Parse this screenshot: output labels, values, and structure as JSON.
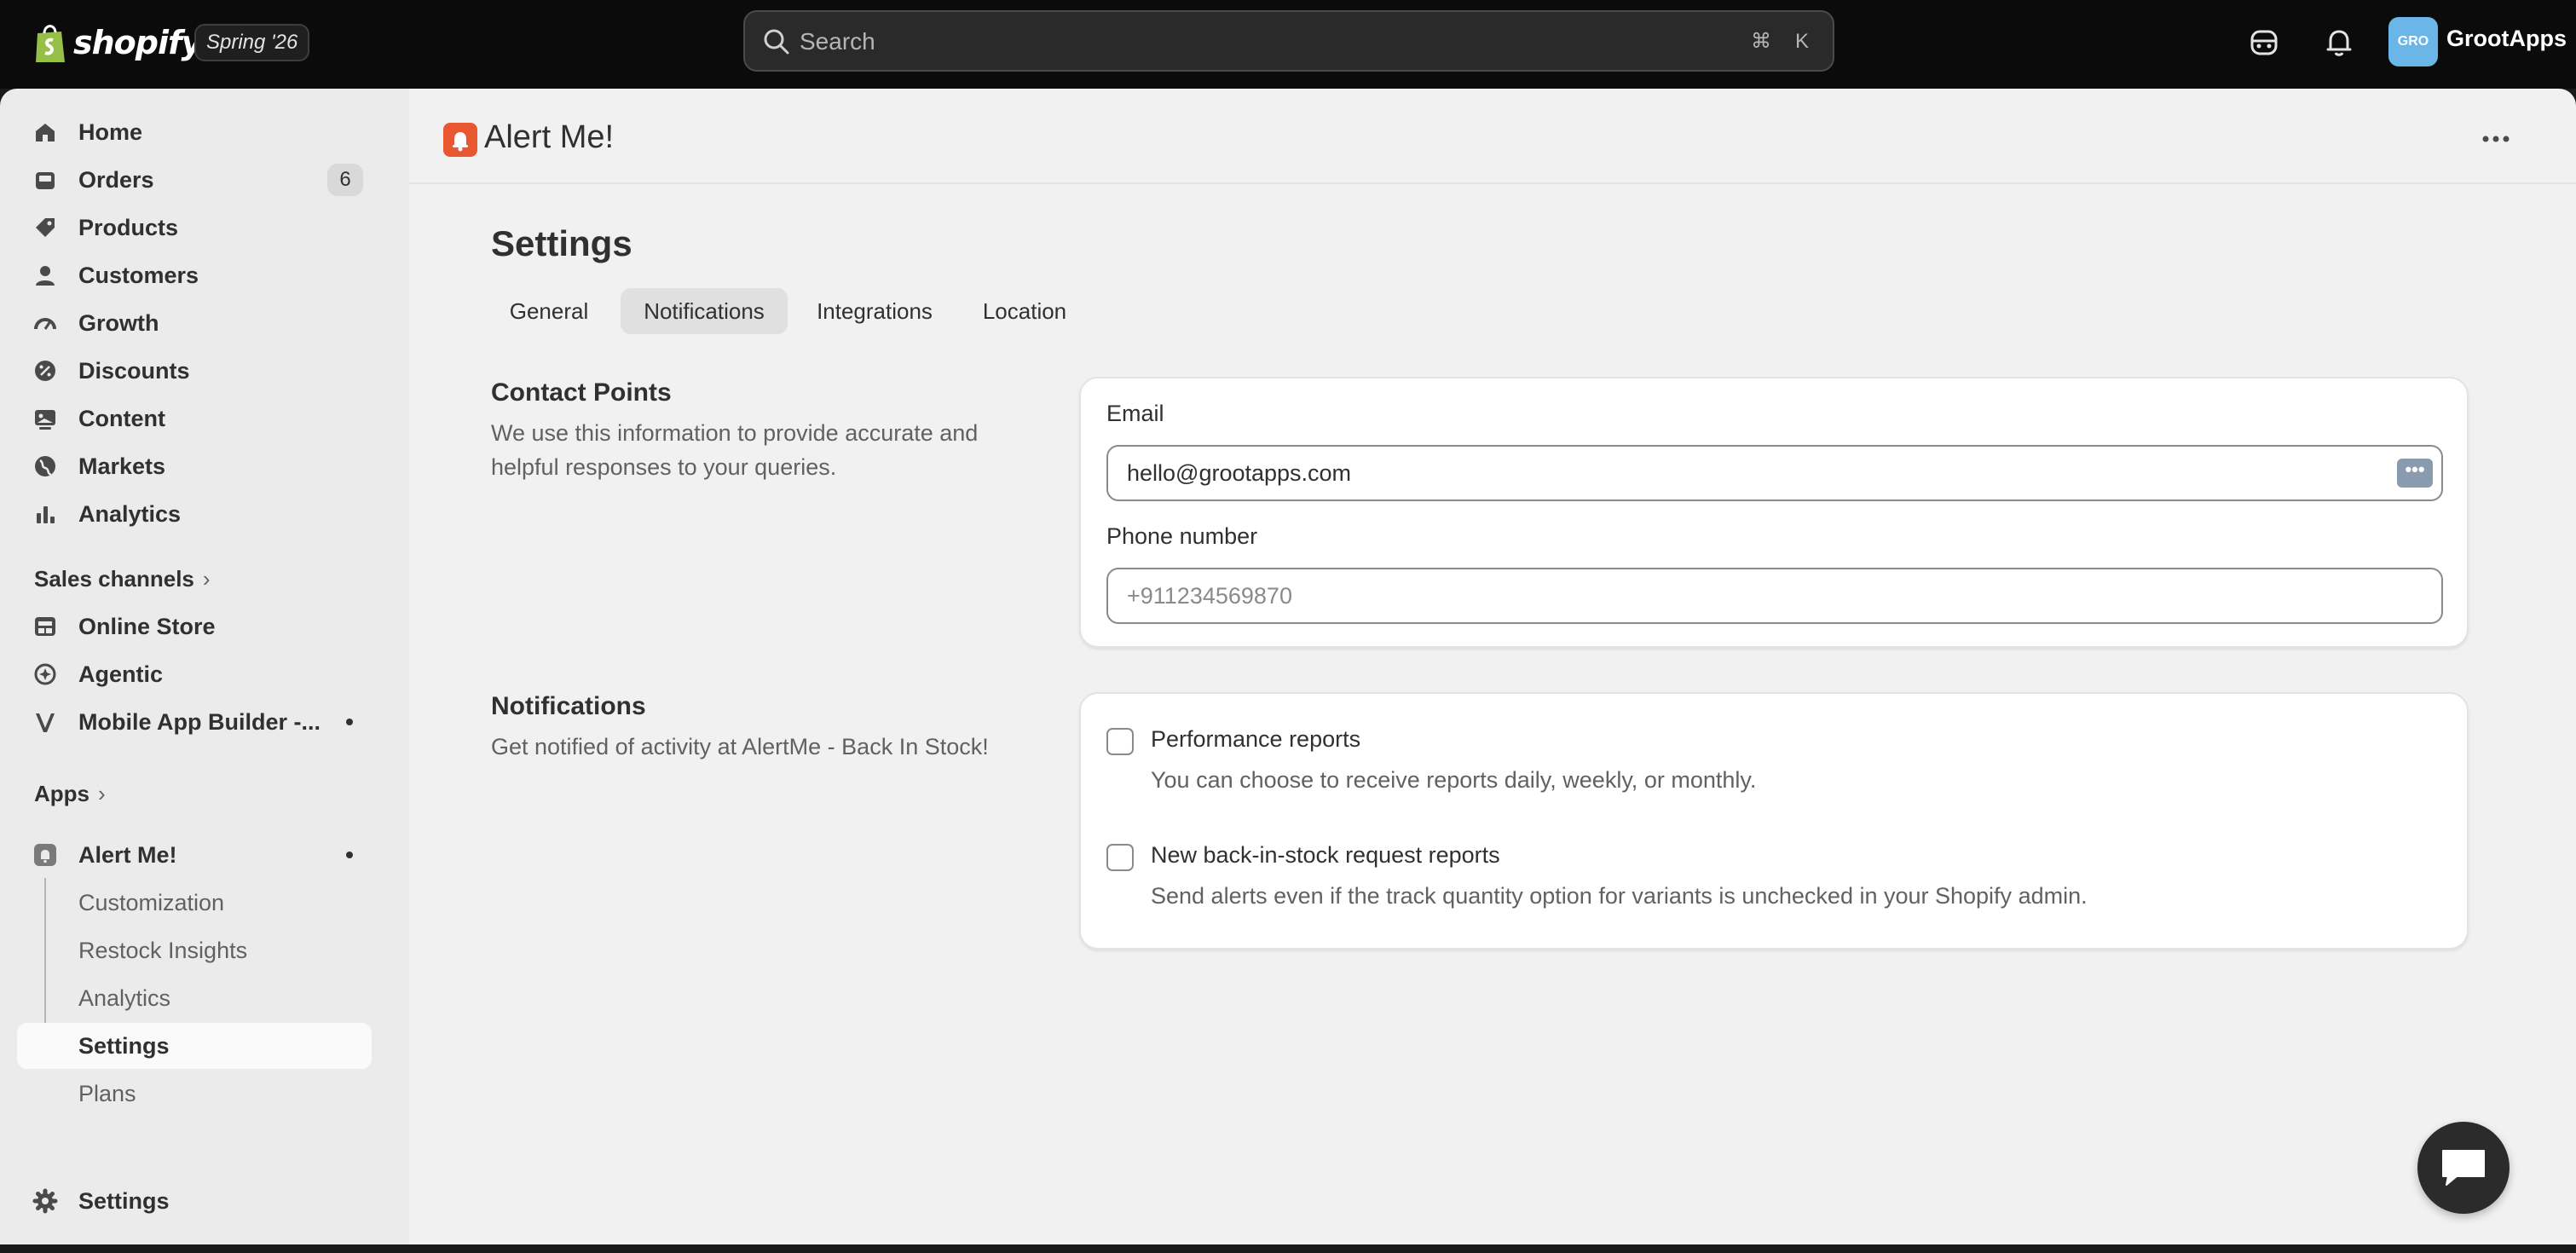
{
  "topbar": {
    "brand": "shopify",
    "edition": "Spring '26",
    "search_placeholder": "Search",
    "shortcut_cmd": "⌘",
    "shortcut_key": "K",
    "avatar_initials": "GRO",
    "store_name": "GrootApps"
  },
  "sidebar": {
    "items": [
      {
        "label": "Home",
        "icon": "home-icon"
      },
      {
        "label": "Orders",
        "icon": "orders-icon",
        "count": "6"
      },
      {
        "label": "Products",
        "icon": "tag-icon"
      },
      {
        "label": "Customers",
        "icon": "person-icon"
      },
      {
        "label": "Growth",
        "icon": "gauge-icon"
      },
      {
        "label": "Discounts",
        "icon": "discount-icon"
      },
      {
        "label": "Content",
        "icon": "image-icon"
      },
      {
        "label": "Markets",
        "icon": "globe-icon"
      },
      {
        "label": "Analytics",
        "icon": "bar-chart-icon"
      }
    ],
    "sales_channels_label": "Sales channels",
    "sales_channels": [
      {
        "label": "Online Store",
        "icon": "store-icon"
      },
      {
        "label": "Agentic",
        "icon": "sparkle-icon"
      },
      {
        "label": "Mobile App Builder -...",
        "icon": "v-logo-icon"
      }
    ],
    "apps_label": "Apps",
    "app": {
      "label": "Alert Me!",
      "icon": "bell-app-icon"
    },
    "app_subitems": [
      "Customization",
      "Restock Insights",
      "Analytics",
      "Settings",
      "Plans"
    ],
    "settings_label": "Settings"
  },
  "main": {
    "app_title": "Alert Me!",
    "page_title": "Settings",
    "tabs": [
      "General",
      "Notifications",
      "Integrations",
      "Location"
    ],
    "active_tab": "Notifications",
    "contact": {
      "title": "Contact Points",
      "description": "We use this information to provide accurate and helpful responses to your queries.",
      "email_label": "Email",
      "email_value": "hello@grootapps.com",
      "phone_label": "Phone number",
      "phone_placeholder": "+911234569870"
    },
    "notifications": {
      "title": "Notifications",
      "description": "Get notified of activity at AlertMe - Back In Stock!",
      "options": [
        {
          "label": "Performance reports",
          "help": "You can choose to receive reports daily, weekly, or monthly.",
          "checked": false
        },
        {
          "label": "New back-in-stock request reports",
          "help": "Send alerts even if the track quantity option for variants is unchecked in your Shopify admin.",
          "checked": false
        }
      ]
    }
  },
  "colors": {
    "topbar_bg": "#0b0b0b",
    "sidebar_bg": "#ebebeb",
    "main_bg": "#f1f1f1",
    "app_logo": "#e8572f",
    "avatar": "#6bb6e8"
  }
}
